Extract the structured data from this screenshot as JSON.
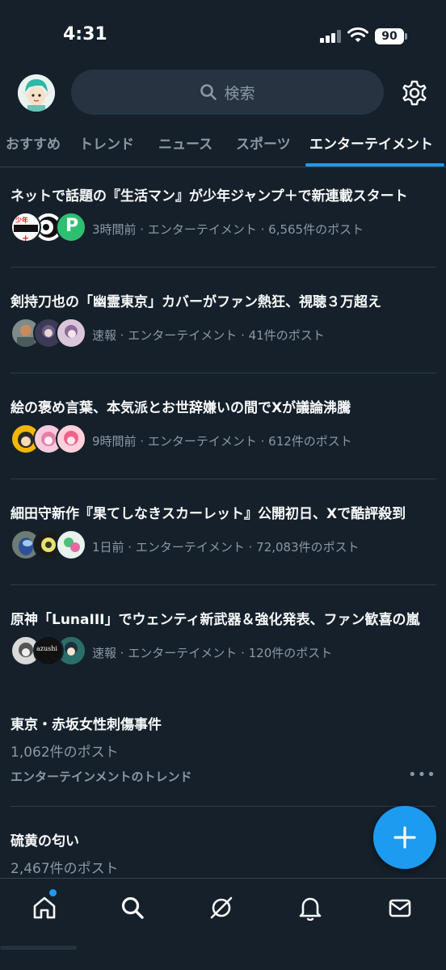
{
  "status_bar": {
    "time": "4:31",
    "battery": "90"
  },
  "header": {
    "search_placeholder": "検索"
  },
  "tabs": [
    {
      "label": "おすすめ"
    },
    {
      "label": "トレンド"
    },
    {
      "label": "ニュース"
    },
    {
      "label": "スポーツ"
    },
    {
      "label": "エンターテイメント"
    }
  ],
  "trends": [
    {
      "title": "ネットで話題の『生活マン』が少年ジャンプ＋で新連載スタート",
      "meta": "3時間前 · エンターテイメント · 6,565件のポスト"
    },
    {
      "title": "剣持刀也の「幽霊東京」カバーがファン熱狂、視聴３万超え",
      "meta": "速報 · エンターテイメント · 41件のポスト"
    },
    {
      "title": "絵の褒め言葉、本気派とお世辞嫌いの間でXが議論沸騰",
      "meta": "9時間前 · エンターテイメント · 612件のポスト"
    },
    {
      "title": "細田守新作『果てしなきスカーレット』公開初日、Xで酷評殺到",
      "meta": "1日前 · エンターテイメント · 72,083件のポスト"
    },
    {
      "title": "原神「LunaIII」でウェンティ新武器＆強化発表、ファン歓喜の嵐",
      "meta": "速報 · エンターテイメント · 120件のポスト"
    }
  ],
  "plain_trends": [
    {
      "title": "東京・赤坂女性刺傷事件",
      "count": "1,062件のポスト",
      "sub": "エンターテインメントのトレンド"
    },
    {
      "title": "硫黄の匂い",
      "count": "2,467件のポスト"
    }
  ],
  "thumb_texts": {
    "jump": "少年",
    "azushi": "azushi"
  },
  "icons": [
    "search-icon",
    "gear-icon",
    "home-icon",
    "explore-icon",
    "grok-icon",
    "bell-icon",
    "mail-icon",
    "plus-icon"
  ],
  "colors": {
    "background": "#15202b",
    "accent": "#1d9bf0",
    "muted": "#8b98a5"
  }
}
